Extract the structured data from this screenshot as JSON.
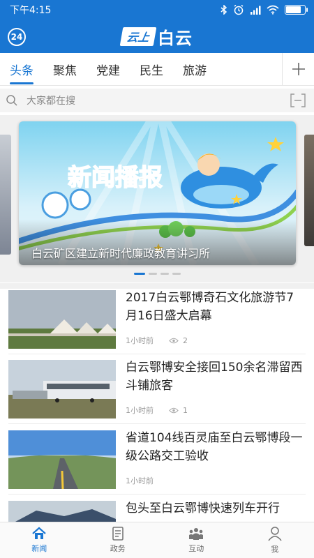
{
  "status": {
    "time": "下午4:15"
  },
  "header": {
    "weather_badge": "24",
    "logo_badge": "云上",
    "logo_text": "白云"
  },
  "tabs": [
    {
      "label": "头条",
      "active": true
    },
    {
      "label": "聚焦",
      "active": false
    },
    {
      "label": "党建",
      "active": false
    },
    {
      "label": "民生",
      "active": false
    },
    {
      "label": "旅游",
      "active": false
    }
  ],
  "search": {
    "placeholder": "大家都在搜"
  },
  "carousel": {
    "banner_title": "新闻播报",
    "caption": "白云矿区建立新时代廉政教育讲习所",
    "slide_count": 4,
    "active_index": 0
  },
  "news": [
    {
      "title": "2017白云鄂博奇石文化旅游节7月16日盛大启幕",
      "time": "1小时前",
      "views": "2"
    },
    {
      "title": "白云鄂博安全接回150余名滞留西斗铺旅客",
      "time": "1小时前",
      "views": "1"
    },
    {
      "title": "省道104线百灵庙至白云鄂博段一级公路交工验收",
      "time": "1小时前",
      "views": ""
    },
    {
      "title": "包头至白云鄂博快速列车开行",
      "time": "",
      "views": ""
    }
  ],
  "bottom_nav": [
    {
      "label": "新闻",
      "icon": "home-icon",
      "active": true
    },
    {
      "label": "政务",
      "icon": "document-icon",
      "active": false
    },
    {
      "label": "互动",
      "icon": "people-icon",
      "active": false
    },
    {
      "label": "我",
      "icon": "user-icon",
      "active": false
    }
  ],
  "colors": {
    "accent": "#1976d2",
    "battery_level": 0.85
  }
}
